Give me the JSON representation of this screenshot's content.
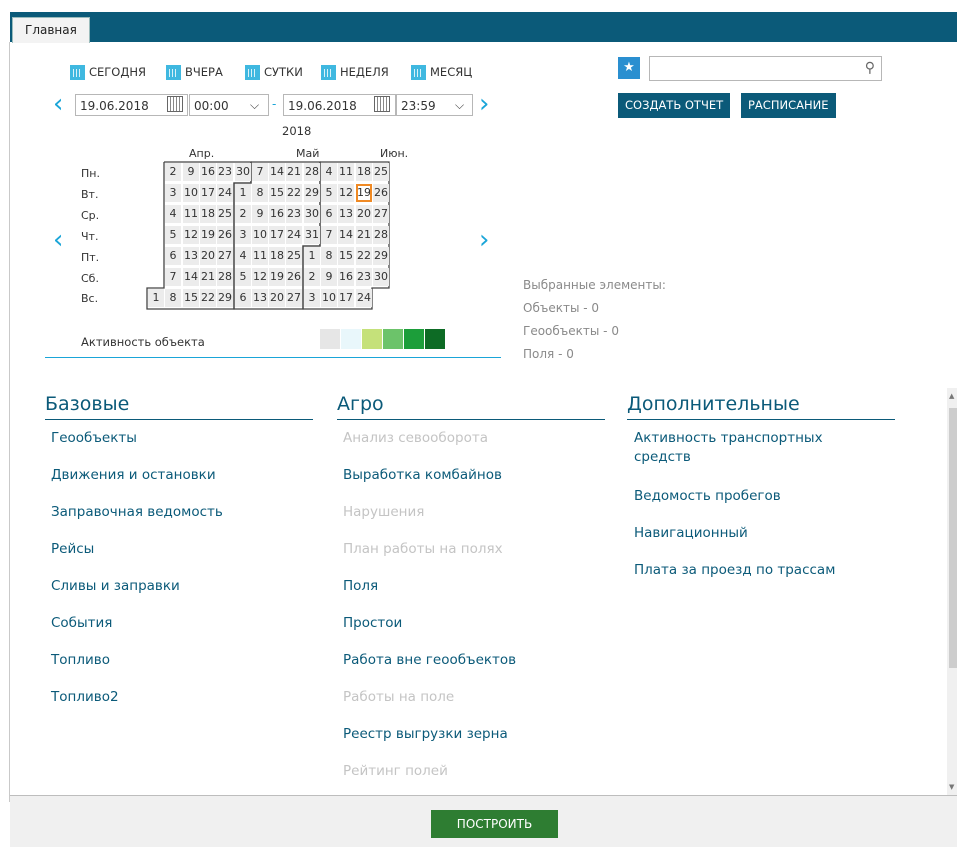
{
  "tab": {
    "label": "Главная"
  },
  "periods": [
    {
      "label": "СЕГОДНЯ"
    },
    {
      "label": "ВЧЕРА"
    },
    {
      "label": "СУТКИ"
    },
    {
      "label": "НЕДЕЛЯ"
    },
    {
      "label": "МЕСЯЦ"
    }
  ],
  "range": {
    "from_date": "19.06.2018",
    "from_time": "00:00",
    "separator": "-",
    "to_date": "19.06.2018",
    "to_time": "23:59"
  },
  "calendar": {
    "year": "2018",
    "months": [
      "Апр.",
      "Май",
      "Июн."
    ],
    "weekdays": [
      "Пн.",
      "Вт.",
      "Ср.",
      "Чт.",
      "Пт.",
      "Сб.",
      "Вс."
    ],
    "weeks": [
      [
        "",
        "",
        "",
        "",
        "",
        "",
        "1"
      ],
      [
        "2",
        "3",
        "4",
        "5",
        "6",
        "7",
        "8"
      ],
      [
        "9",
        "10",
        "11",
        "12",
        "13",
        "14",
        "15"
      ],
      [
        "16",
        "17",
        "18",
        "19",
        "20",
        "21",
        "22"
      ],
      [
        "23",
        "24",
        "25",
        "26",
        "27",
        "28",
        "29"
      ],
      [
        "30",
        "1",
        "2",
        "3",
        "4",
        "5",
        "6"
      ],
      [
        "7",
        "8",
        "9",
        "10",
        "11",
        "12",
        "13"
      ],
      [
        "14",
        "15",
        "16",
        "17",
        "18",
        "19",
        "20"
      ],
      [
        "21",
        "22",
        "23",
        "24",
        "25",
        "26",
        "27"
      ],
      [
        "28",
        "29",
        "30",
        "31",
        "1",
        "2",
        "3"
      ],
      [
        "4",
        "5",
        "6",
        "7",
        "8",
        "9",
        "10"
      ],
      [
        "11",
        "12",
        "13",
        "14",
        "15",
        "16",
        "17"
      ],
      [
        "18",
        "19",
        "20",
        "21",
        "22",
        "23",
        "24"
      ],
      [
        "25",
        "26",
        "27",
        "28",
        "29",
        "30",
        ""
      ]
    ],
    "selected_day": "19",
    "activity_label": "Активность объекта",
    "activity_colors": [
      "#e6e6e6",
      "#e9f7fb",
      "#c5e17a",
      "#6cc36a",
      "#1c9e3a",
      "#0d6b25"
    ]
  },
  "selection": {
    "title": "Выбранные элементы:",
    "objects": "Объекты - 0",
    "geoobjects": "Геообъекты - 0",
    "fields": "Поля - 0"
  },
  "search": {
    "value": "",
    "placeholder": ""
  },
  "buttons": {
    "create_report": "СОЗДАТЬ ОТЧЕТ",
    "schedule": "РАСПИСАНИЕ",
    "build": "ПОСТРОИТЬ"
  },
  "columns": [
    {
      "title": "Базовые",
      "items": [
        {
          "label": "Геообъекты",
          "enabled": true
        },
        {
          "label": "Движения и остановки",
          "enabled": true
        },
        {
          "label": "Заправочная ведомость",
          "enabled": true
        },
        {
          "label": "Рейсы",
          "enabled": true
        },
        {
          "label": "Сливы и заправки",
          "enabled": true
        },
        {
          "label": "События",
          "enabled": true
        },
        {
          "label": "Топливо",
          "enabled": true
        },
        {
          "label": "Топливо2",
          "enabled": true
        }
      ]
    },
    {
      "title": "Агро",
      "items": [
        {
          "label": "Анализ севооборота",
          "enabled": false
        },
        {
          "label": "Выработка комбайнов",
          "enabled": true
        },
        {
          "label": "Нарушения",
          "enabled": false
        },
        {
          "label": "План работы на полях",
          "enabled": false
        },
        {
          "label": "Поля",
          "enabled": true
        },
        {
          "label": "Простои",
          "enabled": true
        },
        {
          "label": "Работа вне геообъектов",
          "enabled": true
        },
        {
          "label": "Работы на поле",
          "enabled": false
        },
        {
          "label": "Реестр выгрузки зерна",
          "enabled": true
        },
        {
          "label": "Рейтинг полей",
          "enabled": false
        }
      ]
    },
    {
      "title": "Дополнительные",
      "items": [
        {
          "label": "Активность транспортных",
          "label2": "средств",
          "enabled": true
        },
        {
          "label": "Ведомость пробегов",
          "enabled": true
        },
        {
          "label": "Навигационный",
          "enabled": true
        },
        {
          "label": "Плата за проезд по трассам",
          "enabled": true
        }
      ]
    }
  ]
}
